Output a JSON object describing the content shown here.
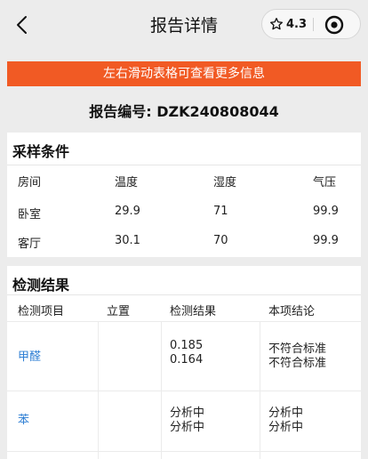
{
  "header": {
    "title": "报告详情",
    "rating": "4.3"
  },
  "hint": "左右滑动表格可查看更多信息",
  "report": {
    "label": "报告编号:",
    "number": "DZK240808044"
  },
  "sampling": {
    "title": "采样条件",
    "columns": [
      "房间",
      "温度",
      "湿度",
      "气压"
    ],
    "rows": [
      [
        "卧室",
        "29.9",
        "71",
        "99.9"
      ],
      [
        "客厅",
        "30.1",
        "70",
        "99.9"
      ]
    ]
  },
  "results": {
    "title": "检测结果",
    "columns": [
      "检测项目",
      "立置",
      "检测结果",
      "本项结论"
    ],
    "rows": [
      {
        "item": "甲醛",
        "position": "",
        "result_1": "0.185",
        "result_2": "0.164",
        "conclusion_1": "不符合标准",
        "conclusion_2": "不符合标准"
      },
      {
        "item": "苯",
        "position": "",
        "result_1": "分析中",
        "result_2": "分析中",
        "conclusion_1": "分析中",
        "conclusion_2": "分析中"
      }
    ]
  },
  "colors": {
    "accent": "#f15a24",
    "link": "#2f7fd4",
    "background": "#ececec"
  }
}
